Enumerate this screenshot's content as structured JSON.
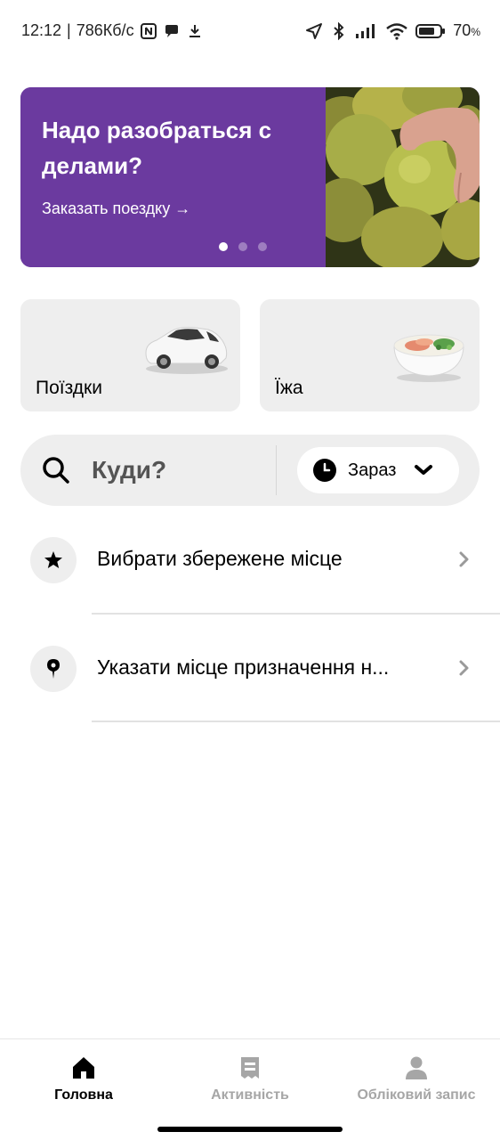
{
  "status_bar": {
    "time": "12:12",
    "separator": "|",
    "speed": "786Кб/с",
    "battery": "70",
    "battery_unit": "%"
  },
  "banner": {
    "title": "Надо разобраться с делами?",
    "cta": "Заказать поездку →",
    "slides": 3,
    "active_slide": 1
  },
  "services": {
    "rides_label": "Поїздки",
    "food_label": "Їжа"
  },
  "search": {
    "label": "Куди?",
    "time_label": "Зараз"
  },
  "list": {
    "saved_place": "Вибрати збережене місце",
    "destination": "Указати місце призначення н..."
  },
  "nav": {
    "home": "Головна",
    "activity": "Активність",
    "account": "Обліковий запис"
  },
  "colors": {
    "banner_purple": "#6b3a9f",
    "surface_gray": "#eeeeee",
    "inactive_gray": "#a6a6a6"
  }
}
